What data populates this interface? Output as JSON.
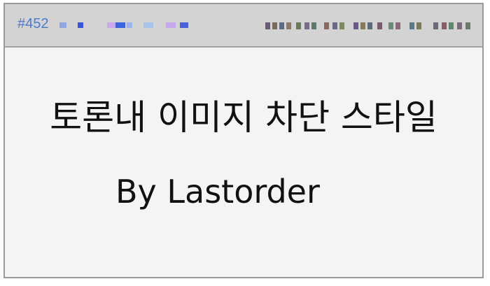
{
  "post": {
    "number": "#452",
    "title": "토론내 이미지 차단 스타일",
    "author_line": "By Lastorder"
  },
  "colors": {
    "header_background": "#d3d3d3",
    "post_number": "#4a7ad0",
    "body_background": "#f4f4f4",
    "text": "#111111"
  }
}
